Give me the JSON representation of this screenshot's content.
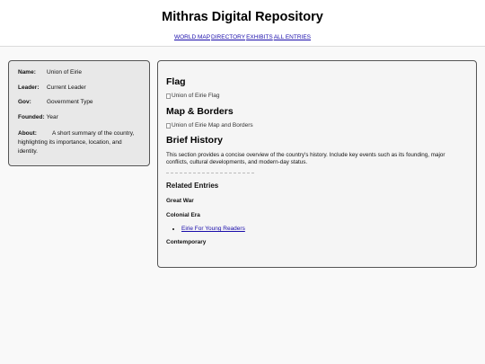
{
  "header": {
    "title": "Mithras Digital Repository",
    "nav": [
      "WORLD MAP",
      "DIRECTORY",
      "EXHIBITS",
      "ALL ENTRIES"
    ]
  },
  "infobox": {
    "name_label": "Name:",
    "name_value": "Union of Eirie",
    "leader_label": "Leader:",
    "leader_value": "Current Leader",
    "gov_label": "Gov:",
    "gov_value": "Government Type",
    "founded_label": "Founded:",
    "founded_value": "Year",
    "about_label": "About:",
    "about_value": "A short summary of the country, highlighting its importance, location, and identity."
  },
  "main": {
    "flag_heading": "Flag",
    "flag_alt": "Union of Eirie Flag",
    "map_heading": "Map & Borders",
    "map_alt": "Union of Eirie Map and Borders",
    "history_heading": "Brief History",
    "history_text": "This section provides a concise overview of the country's history. Include key events such as its founding, major conflicts, cultural developments, and modern-day status.",
    "related_heading": "Related Entries",
    "eras": [
      {
        "title": "Great War",
        "links": []
      },
      {
        "title": "Colonial Era",
        "links": [
          "Eirie For Young Readers"
        ]
      },
      {
        "title": "Contemporary",
        "links": []
      }
    ]
  }
}
